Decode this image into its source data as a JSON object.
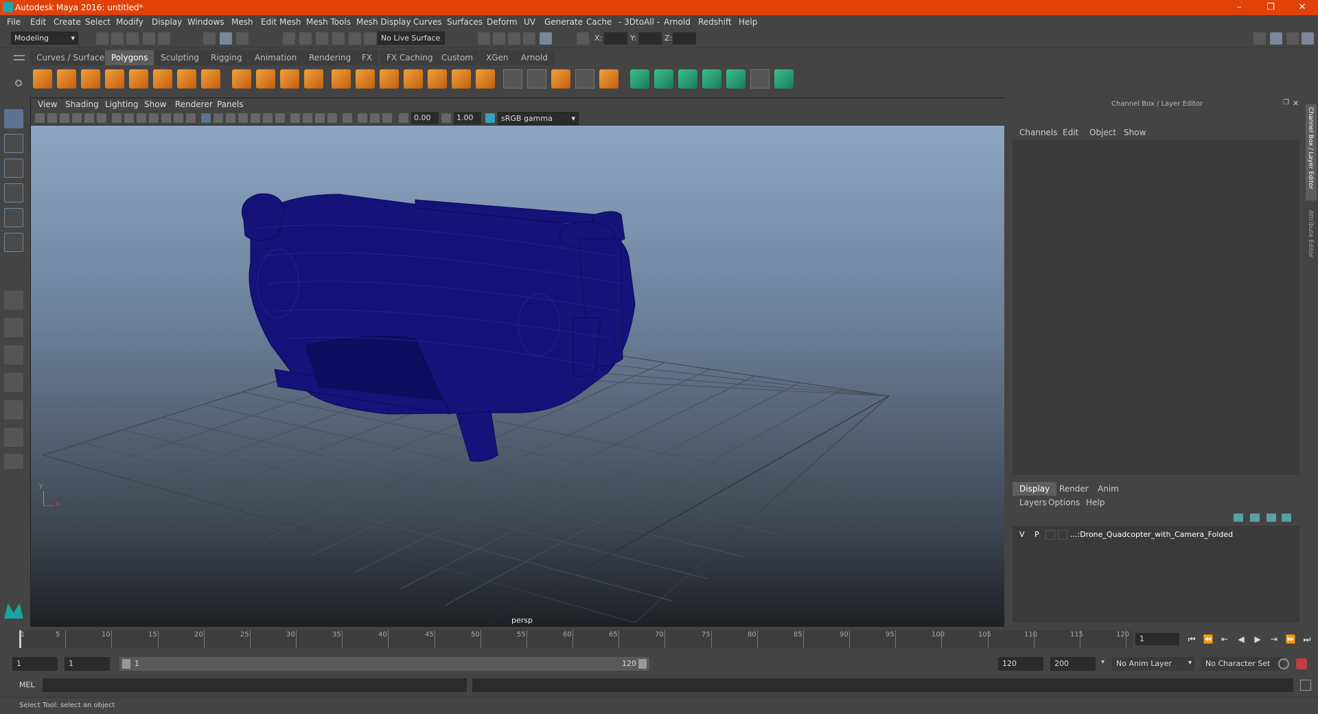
{
  "window": {
    "title": "Autodesk Maya 2016: untitled*"
  },
  "menubar": [
    "File",
    "Edit",
    "Create",
    "Select",
    "Modify",
    "Display",
    "Windows",
    "Mesh",
    "Edit Mesh",
    "Mesh Tools",
    "Mesh Display",
    "Curves",
    "Surfaces",
    "Deform",
    "UV",
    "Generate",
    "Cache",
    "- 3DtoAll -",
    "Arnold",
    "Redshift",
    "Help"
  ],
  "statusline": {
    "mode": "Modeling",
    "live_surface": "No Live Surface",
    "x_label": "X:",
    "y_label": "Y:",
    "z_label": "Z:"
  },
  "shelf_tabs": [
    "Curves / Surfaces",
    "Polygons",
    "Sculpting",
    "Rigging",
    "Animation",
    "Rendering",
    "FX",
    "FX Caching",
    "Custom",
    "XGen",
    "Arnold"
  ],
  "active_shelf_tab": "Polygons",
  "viewport": {
    "menu": [
      "View",
      "Shading",
      "Lighting",
      "Show",
      "Renderer",
      "Panels"
    ],
    "exposure": "0.00",
    "gamma": "1.00",
    "color_space": "sRGB gamma",
    "camera_label": "persp",
    "axis_y": "y",
    "axis_x": "x"
  },
  "channel_box": {
    "title": "Channel Box / Layer Editor",
    "menu": [
      "Channels",
      "Edit",
      "Object",
      "Show"
    ]
  },
  "layer_editor": {
    "tabs": [
      "Display",
      "Render",
      "Anim"
    ],
    "active_tab": "Display",
    "menu": [
      "Layers",
      "Options",
      "Help"
    ],
    "layers": [
      {
        "v": "V",
        "p": "P",
        "name": "...:Drone_Quadcopter_with_Camera_Folded"
      }
    ]
  },
  "side_tabs": [
    "Channel Box / Layer Editor",
    "Attribute Editor"
  ],
  "timeline": {
    "ticks": [
      "5",
      "10",
      "15",
      "20",
      "25",
      "30",
      "35",
      "40",
      "45",
      "50",
      "55",
      "60",
      "65",
      "70",
      "75",
      "80",
      "85",
      "90",
      "95",
      "100",
      "105",
      "110",
      "115",
      "120"
    ],
    "start_tick": "1",
    "current_frame": "1"
  },
  "range": {
    "start": "1",
    "anim_start": "1",
    "slider_start": "1",
    "slider_end": "120",
    "end": "120",
    "anim_end": "200",
    "anim_layer": "No Anim Layer",
    "char_set": "No Character Set"
  },
  "cmd": {
    "label": "MEL"
  },
  "help_line": "Select Tool: select an object",
  "colors": {
    "title": "#e2410a",
    "wire": "#14137a",
    "accent": "#5d5d5d"
  }
}
